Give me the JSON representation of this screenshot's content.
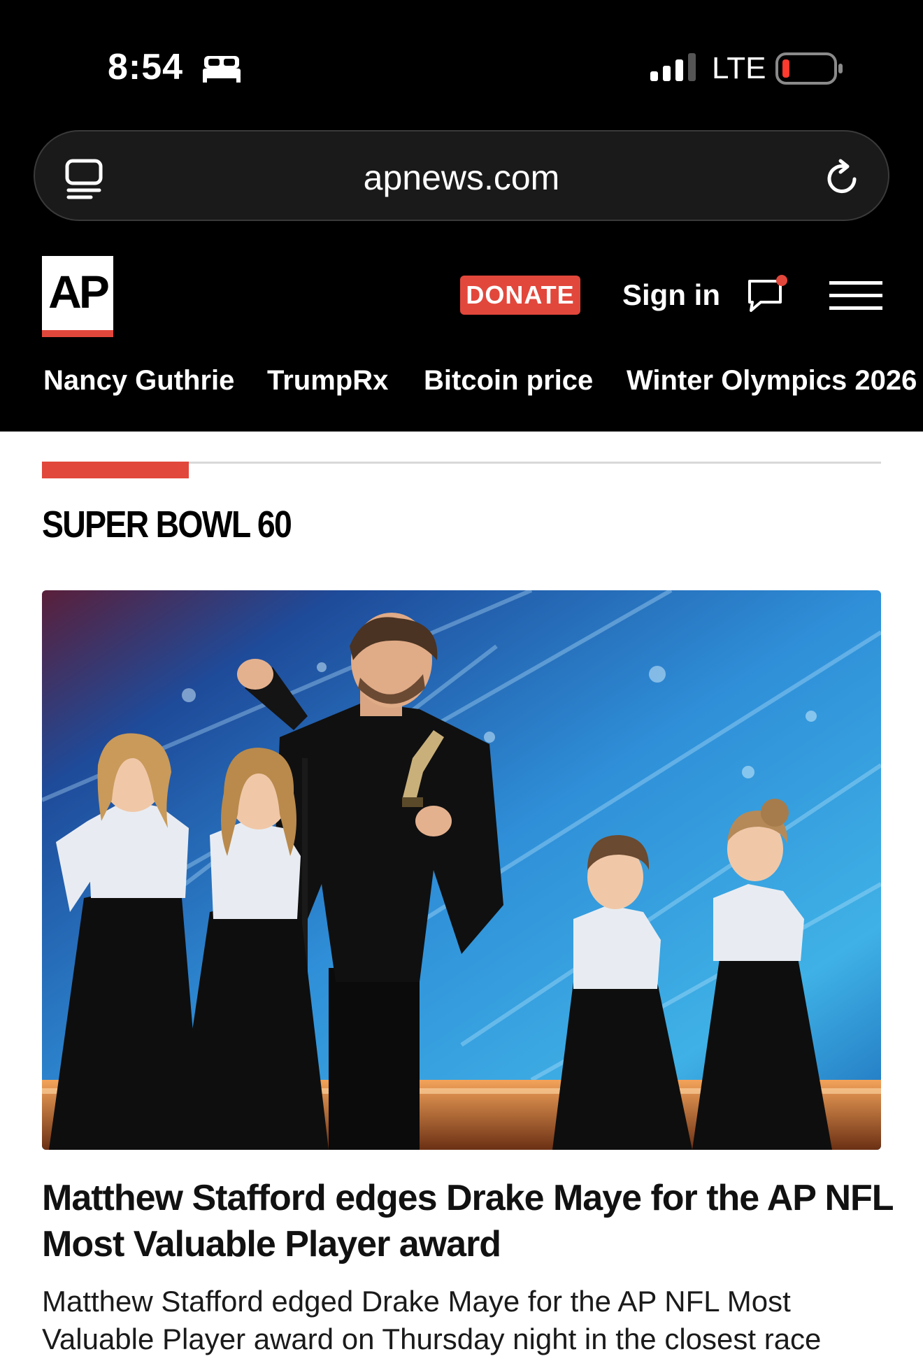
{
  "status_bar": {
    "time": "8:54",
    "carrier": "LTE",
    "icons": [
      "sleep-icon",
      "cellular-signal-icon",
      "battery-low-icon"
    ]
  },
  "browser": {
    "url": "apnews.com",
    "icons": [
      "tabs-icon",
      "reload-icon"
    ]
  },
  "header": {
    "logo_text": "AP",
    "donate_label": "DONATE",
    "signin_label": "Sign in",
    "icons": [
      "chat-icon",
      "hamburger-menu-icon"
    ]
  },
  "trending": [
    {
      "label": "Nancy Guthrie"
    },
    {
      "label": "TrumpRx"
    },
    {
      "label": "Bitcoin price"
    },
    {
      "label": "Winter Olympics 2026"
    }
  ],
  "section": {
    "title": "SUPER BOWL 60"
  },
  "article": {
    "headline": "Matthew Stafford edges Drake Maye for the AP NFL Most Valuable Player award",
    "summary": "Matthew Stafford edged Drake Maye for the AP NFL Most Valuable Player award on Thursday night in the closest race"
  },
  "colors": {
    "accent_red": "#e2473c",
    "header_bg": "#000000",
    "page_bg": "#ffffff"
  }
}
